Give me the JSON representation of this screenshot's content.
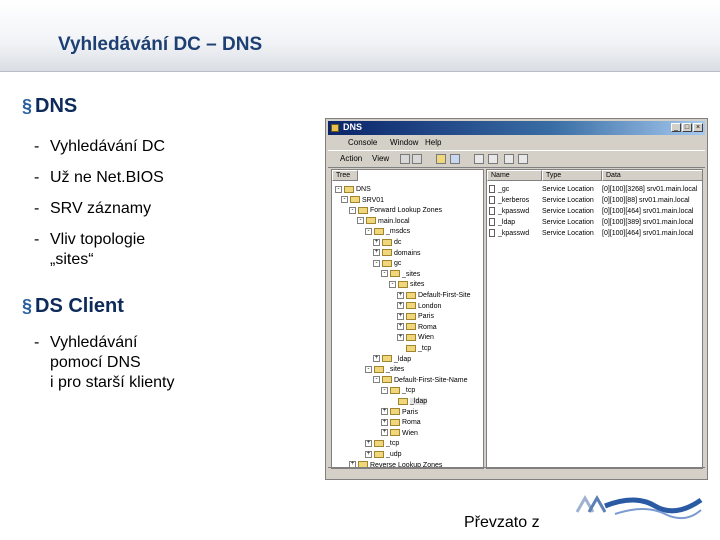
{
  "slide": {
    "title": "Vyhledávání DC – DNS",
    "bullets": [
      {
        "label": "DNS",
        "items": [
          "Vyhledávání DC",
          "Už ne Net.BIOS",
          "SRV záznamy",
          "Vliv topologie\n„sites“"
        ]
      },
      {
        "label": "DS Client",
        "items": [
          "Vyhledávání\npomocí DNS\ni pro starší klienty"
        ]
      }
    ],
    "credit": "Převzato z"
  },
  "window": {
    "title": "DNS",
    "controls": [
      "_",
      "□",
      "×"
    ],
    "menu": [
      "Console",
      "Window",
      "Help"
    ],
    "toolbar": {
      "action": "Action",
      "view": "View"
    },
    "tree_header": "Tree",
    "tree": [
      {
        "text": "DNS",
        "toggle": "-"
      },
      {
        "text": "SRV01",
        "toggle": "-"
      },
      {
        "text": "Forward Lookup Zones",
        "toggle": "-"
      },
      {
        "text": "main.local",
        "toggle": "-"
      },
      {
        "text": "_msdcs",
        "toggle": "-"
      },
      {
        "text": "dc",
        "toggle": "+"
      },
      {
        "text": "domains",
        "toggle": "+"
      },
      {
        "text": "gc",
        "toggle": "-"
      },
      {
        "text": "_sites",
        "toggle": "-"
      },
      {
        "text": "sites",
        "toggle": "-"
      },
      {
        "text": "Default-First-Site",
        "toggle": "+"
      },
      {
        "text": "London",
        "toggle": "+"
      },
      {
        "text": "Paris",
        "toggle": "+"
      },
      {
        "text": "Roma",
        "toggle": "+"
      },
      {
        "text": "Wien",
        "toggle": "+"
      },
      {
        "text": "_tcp",
        "toggle": ""
      },
      {
        "text": "_ldap",
        "toggle": "+"
      },
      {
        "text": "_sites",
        "toggle": "-"
      },
      {
        "text": "Default-First-Site-Name",
        "toggle": "-"
      },
      {
        "text": "_tcp",
        "toggle": "-"
      },
      {
        "text": "_ldap",
        "toggle": ""
      },
      {
        "text": "Paris",
        "toggle": "+"
      },
      {
        "text": "Roma",
        "toggle": "+"
      },
      {
        "text": "Wien",
        "toggle": "+"
      },
      {
        "text": "_tcp",
        "toggle": "+"
      },
      {
        "text": "_udp",
        "toggle": "+"
      },
      {
        "text": "Reverse Lookup Zones",
        "toggle": "+"
      }
    ],
    "list_headers": {
      "name": "Name",
      "type": "Type",
      "data": "Data"
    },
    "list": [
      {
        "name": "_gc",
        "type": "Service Location",
        "data": "[0][100][3268] srv01.main.local"
      },
      {
        "name": "_kerberos",
        "type": "Service Location",
        "data": "[0][100][88] srv01.main.local"
      },
      {
        "name": "_kpasswd",
        "type": "Service Location",
        "data": "[0][100][464] srv01.main.local"
      },
      {
        "name": "_ldap",
        "type": "Service Location",
        "data": "[0][100][389] srv01.main.local"
      },
      {
        "name": "_kpasswd",
        "type": "Service Location",
        "data": "[0][100][464] srv01.main.local"
      }
    ]
  }
}
